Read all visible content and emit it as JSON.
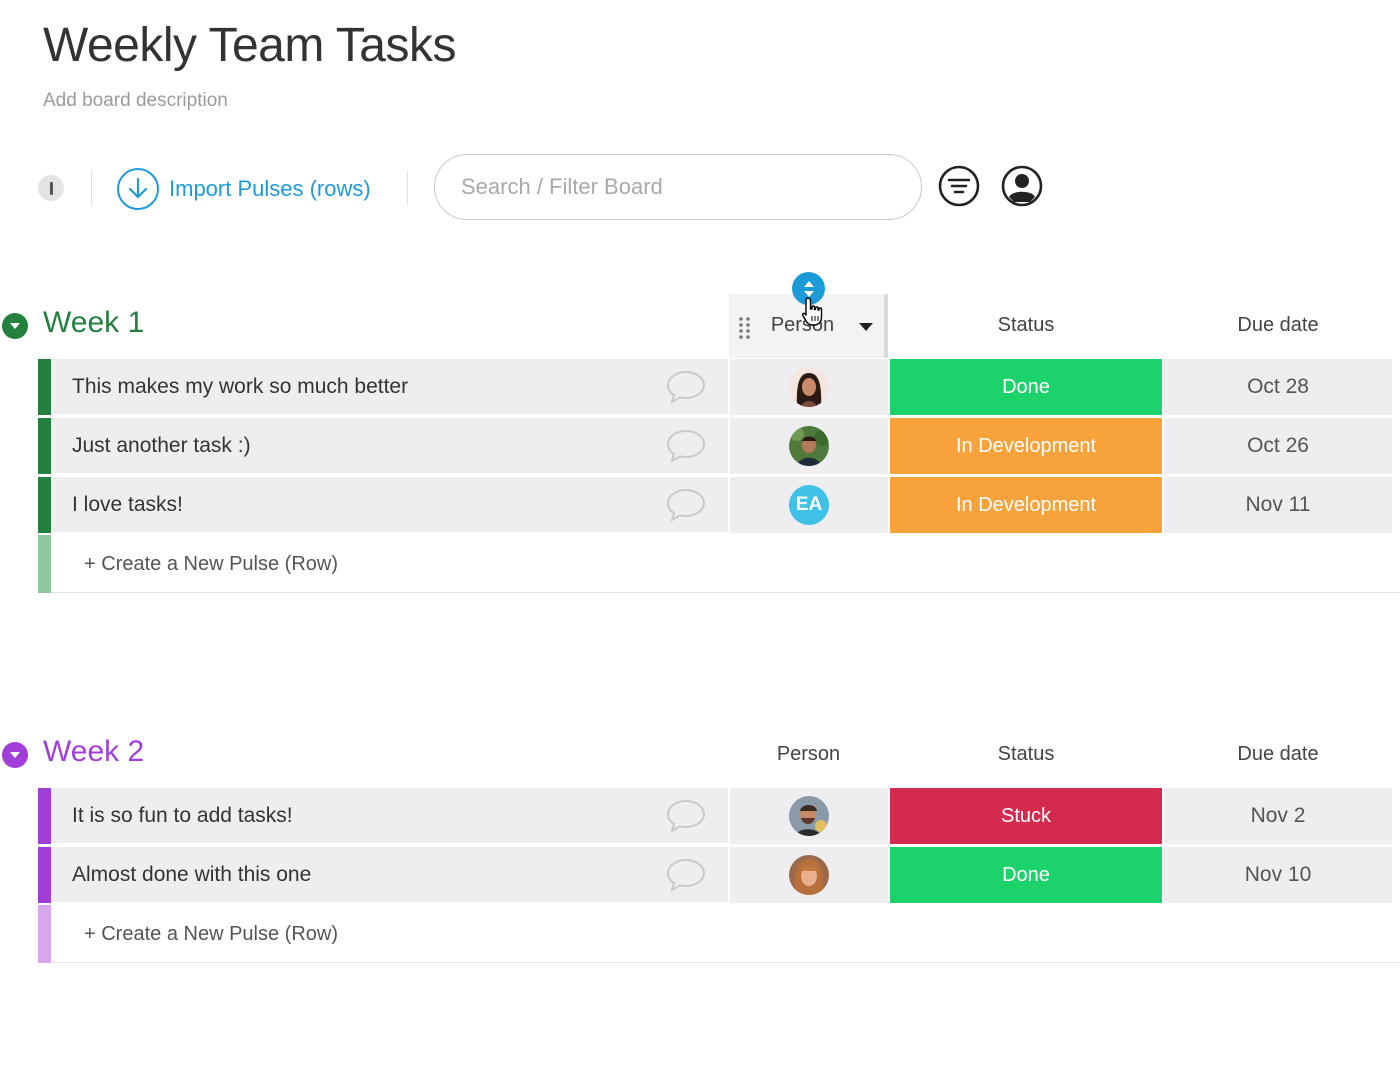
{
  "board": {
    "title": "Weekly Team Tasks",
    "description": "Add board description"
  },
  "toolbar": {
    "import_label": "Import Pulses (rows)",
    "search_placeholder": "Search / Filter Board"
  },
  "colors": {
    "accent": "#1c9bd8",
    "done": "#1bd36a",
    "in_development": "#f7a23b",
    "stuck": "#d42a4e",
    "week1": "#23803f",
    "week2": "#a23ed8"
  },
  "columns": {
    "person": "Person",
    "status": "Status",
    "due_date": "Due date"
  },
  "groups": [
    {
      "title": "Week 1",
      "rows": [
        {
          "name": "This makes my work so much better",
          "person": "avatar-woman-dark-hair",
          "status": "Done",
          "due": "Oct 28"
        },
        {
          "name": "Just another task :)",
          "person": "avatar-man-outdoors",
          "status": "In Development",
          "due": "Oct 26"
        },
        {
          "name": "I love tasks!",
          "person_initials": "EA",
          "status": "In Development",
          "due": "Nov 11"
        }
      ],
      "create_label": "+ Create a New Pulse (Row)"
    },
    {
      "title": "Week 2",
      "rows": [
        {
          "name": "It is so fun to add tasks!",
          "person": "avatar-man-beard",
          "status": "Stuck",
          "due": "Nov 2"
        },
        {
          "name": "Almost done with this one",
          "person": "avatar-woman-blonde",
          "status": "Done",
          "due": "Nov 10"
        }
      ],
      "create_label": "+ Create a New Pulse (Row)"
    }
  ]
}
